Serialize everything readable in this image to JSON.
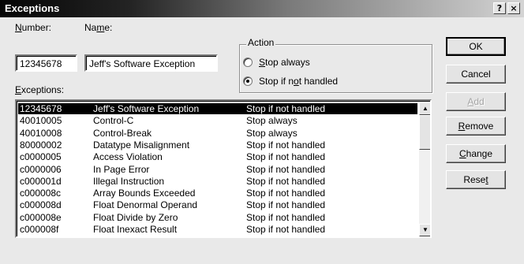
{
  "window": {
    "title": "Exceptions",
    "help_glyph": "?",
    "close_glyph": "×"
  },
  "form": {
    "number_label": "Number:",
    "number_value": "12345678",
    "name_label": "Name:",
    "name_value": "Jeff's Software Exception",
    "exceptions_label": "Exceptions:"
  },
  "action": {
    "legend": "Action",
    "options": [
      {
        "label": "Stop always",
        "selected": false
      },
      {
        "label": "Stop if not handled",
        "selected": true
      }
    ]
  },
  "exceptions": [
    {
      "code": "12345678",
      "name": "Jeff's Software Exception",
      "action": "Stop if not handled",
      "selected": true
    },
    {
      "code": "40010005",
      "name": "Control-C",
      "action": "Stop always"
    },
    {
      "code": "40010008",
      "name": "Control-Break",
      "action": "Stop always"
    },
    {
      "code": "80000002",
      "name": "Datatype Misalignment",
      "action": "Stop if not handled"
    },
    {
      "code": "c0000005",
      "name": "Access Violation",
      "action": "Stop if not handled"
    },
    {
      "code": "c0000006",
      "name": "In Page Error",
      "action": "Stop if not handled"
    },
    {
      "code": "c000001d",
      "name": "Illegal Instruction",
      "action": "Stop if not handled"
    },
    {
      "code": "c000008c",
      "name": "Array Bounds Exceeded",
      "action": "Stop if not handled"
    },
    {
      "code": "c000008d",
      "name": "Float Denormal Operand",
      "action": "Stop if not handled"
    },
    {
      "code": "c000008e",
      "name": "Float Divide by Zero",
      "action": "Stop if not handled"
    },
    {
      "code": "c000008f",
      "name": "Float Inexact Result",
      "action": "Stop if not handled"
    }
  ],
  "buttons": {
    "ok": "OK",
    "cancel": "Cancel",
    "add": "Add",
    "remove": "Remove",
    "change": "Change",
    "reset": "Reset"
  },
  "scroll": {
    "up_glyph": "▲",
    "down_glyph": "▼"
  }
}
